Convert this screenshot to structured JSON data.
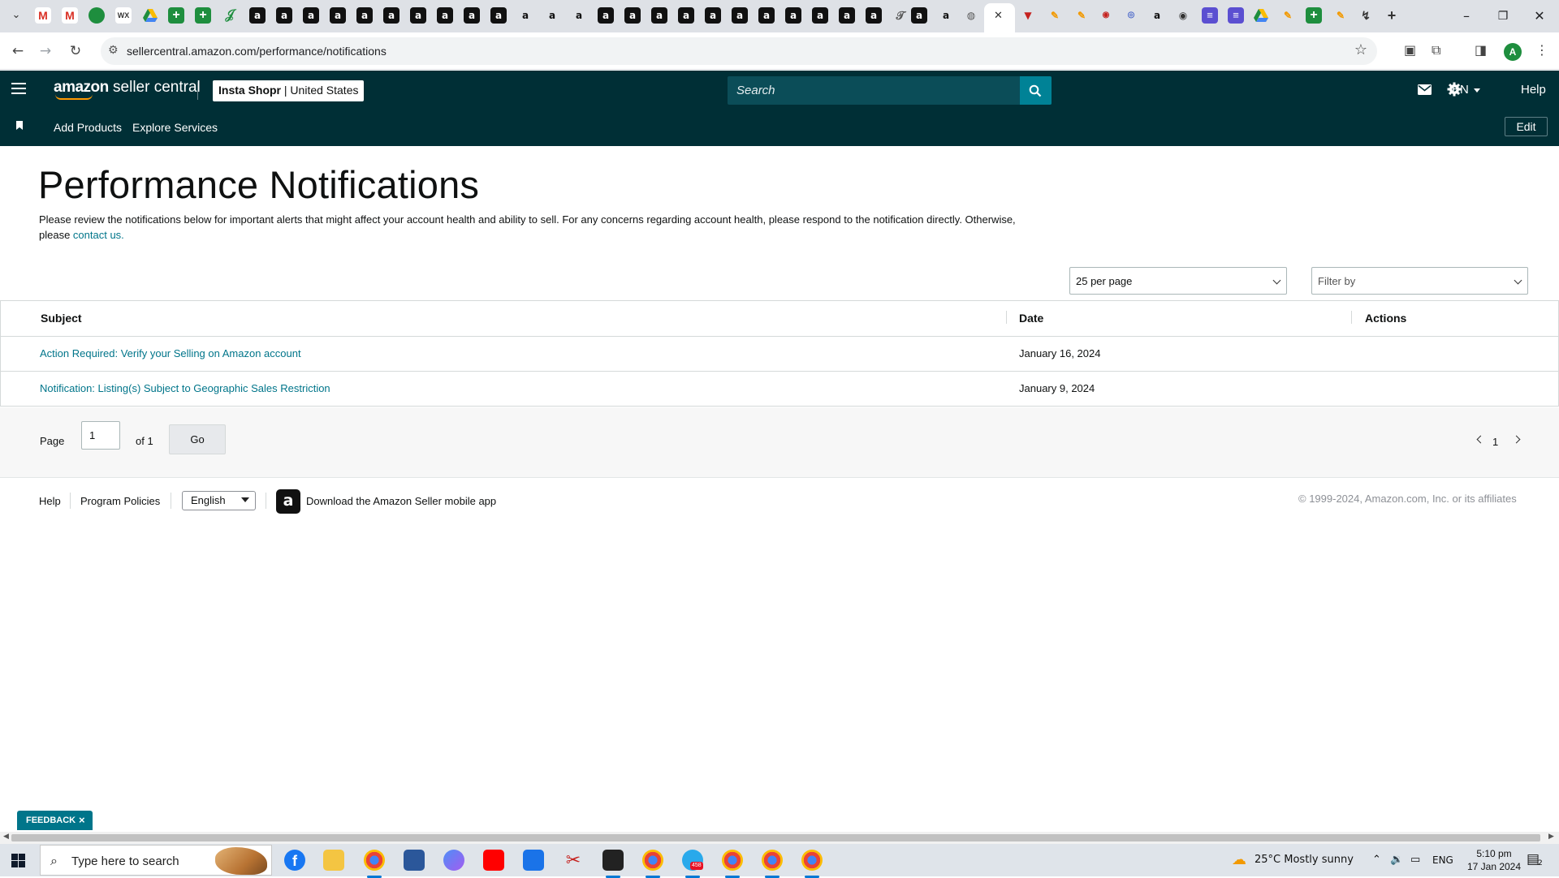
{
  "browser": {
    "url": "sellercentral.amazon.com/performance/notifications",
    "window_controls": {
      "minimize": "–",
      "maximize": "❐",
      "close": "✕"
    },
    "new_tab": "+"
  },
  "header": {
    "logo_brand": "amazon",
    "logo_product": " seller central",
    "store_name": "Insta Shopr",
    "store_region": " | United States",
    "search_placeholder": "Search",
    "language": "EN",
    "help": "Help"
  },
  "nav": {
    "items": [
      {
        "label": "Add Products"
      },
      {
        "label": "Explore Services"
      }
    ],
    "edit": "Edit"
  },
  "page": {
    "title": "Performance Notifications",
    "intro_text": "Please review the notifications below for important alerts that might affect your account health and ability to sell. For any concerns regarding account health, please respond to the notification directly. Otherwise, please ",
    "intro_link": "contact us.",
    "per_page": "25 per page",
    "filter_placeholder": "Filter by"
  },
  "table": {
    "columns": [
      "Subject",
      "Date",
      "Actions"
    ],
    "rows": [
      {
        "subject": "Action Required: Verify your Selling on Amazon account",
        "date": "January 16, 2024"
      },
      {
        "subject": "Notification: Listing(s) Subject to Geographic Sales Restriction",
        "date": "January 9, 2024"
      }
    ]
  },
  "pagination": {
    "page_label": "Page",
    "page_value": "1",
    "of_label": "of 1",
    "go": "Go",
    "current": "1"
  },
  "footer": {
    "help": "Help",
    "policies": "Program Policies",
    "language": "English",
    "app_text": "Download the Amazon Seller mobile app",
    "copyright": "© 1999-2024, Amazon.com, Inc. or its affiliates"
  },
  "feedback": {
    "label": "FEEDBACK",
    "close": "×"
  },
  "taskbar": {
    "search_placeholder": "Type here to search",
    "weather": "25°C  Mostly sunny",
    "language": "ENG",
    "time": "5:10 pm",
    "date": "17 Jan 2024",
    "notification_count": "2",
    "telegram_badge": "458"
  },
  "colors": {
    "header_bg": "#002f36",
    "search_btn": "#008296",
    "link": "#00758a",
    "feedback_bg": "#00758a"
  }
}
